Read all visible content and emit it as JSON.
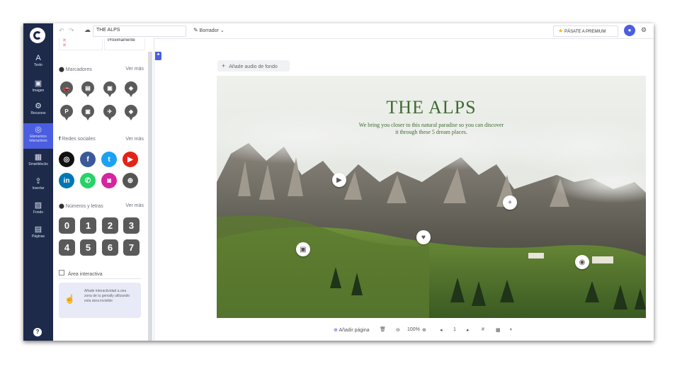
{
  "rail": {
    "items": [
      {
        "icon": "A",
        "label": "Texto"
      },
      {
        "icon": "▣",
        "label": "Imagen"
      },
      {
        "icon": "⚙",
        "label": "Recursos"
      },
      {
        "icon": "◎",
        "label": "Elementos interactivos"
      },
      {
        "icon": "▦",
        "label": "Smartblocks"
      },
      {
        "icon": "⇪",
        "label": "Insertar"
      },
      {
        "icon": "▨",
        "label": "Fondo"
      },
      {
        "icon": "▤",
        "label": "Páginas"
      }
    ],
    "help": "?"
  },
  "topbar": {
    "project_title": "THE ALPS",
    "draft_label": "Borrador",
    "premium_label": "PÁSATE A PREMIUM"
  },
  "panel": {
    "proximamente": "Próximamente",
    "markers": {
      "title": "Marcadores",
      "more": "Ver más",
      "row2": [
        "P",
        "▣",
        "✈",
        "◈"
      ]
    },
    "social": {
      "title": "Redes sociales",
      "more": "Ver más",
      "row1": [
        "◎",
        "f",
        "t",
        "▶"
      ],
      "row2": [
        "in",
        "✆",
        "◙",
        "⊕"
      ]
    },
    "numbers": {
      "title": "Números y letras",
      "more": "Ver más",
      "row1": [
        "0",
        "1",
        "2",
        "3"
      ],
      "row2": [
        "4",
        "5",
        "6",
        "7"
      ]
    },
    "area": {
      "label": "Área interactiva",
      "tip": "Añade interactividad a una zona de tu genially utilizando esta área invisible"
    }
  },
  "canvas": {
    "audio_label": "Añade audio de fondo",
    "slide_title": "THE ALPS",
    "slide_subtitle_1": "We bring you closer to this natural paradise so you can discover",
    "slide_subtitle_2": "it through these 5 dream places."
  },
  "bottombar": {
    "add_page": "Añadir página",
    "zoom": "100%",
    "page": "1"
  },
  "colors": {
    "rail_bg": "#1d2a4a",
    "accent": "#4b5ee0",
    "title_green": "#3f6b33"
  }
}
